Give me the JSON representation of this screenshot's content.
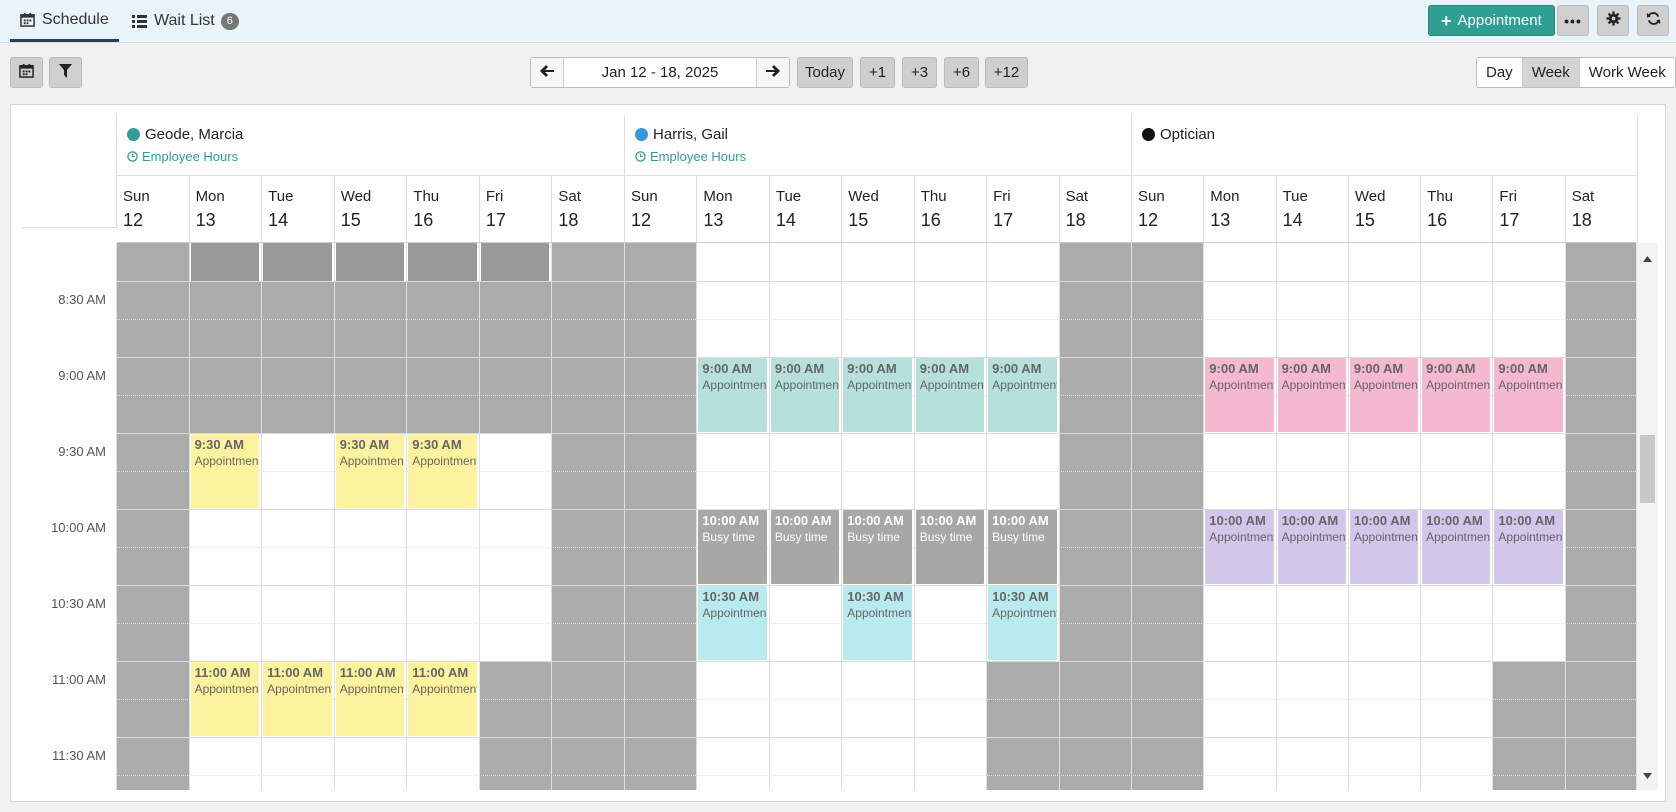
{
  "tabs": [
    {
      "label": "Schedule",
      "icon": "calendar-icon",
      "active": true
    },
    {
      "label": "Wait List",
      "icon": "list-icon",
      "badge": "6"
    }
  ],
  "header": {
    "appointment_label": "Appointment"
  },
  "toolbar": {
    "date_range": "Jan 12 - 18, 2025",
    "today": "Today",
    "jumps": [
      "+1",
      "+3",
      "+6",
      "+12"
    ],
    "views": [
      "Day",
      "Week",
      "Work Week"
    ],
    "selected_view": "Week"
  },
  "colors": {
    "accent": "#2f9e93",
    "off_hours": "#ababab",
    "yellow": "#fdf29e",
    "teal": "#b6e0db",
    "cyan": "#b8eaef",
    "pink": "#f4b8cf",
    "lavender": "#d2c6ea",
    "busy": "#a7a7a7"
  },
  "resources": [
    {
      "name": "Geode, Marcia",
      "dot": "#2f9e93",
      "hours_label": "Employee Hours"
    },
    {
      "name": "Harris, Gail",
      "dot": "#3498db",
      "hours_label": "Employee Hours"
    },
    {
      "name": "Optician",
      "dot": "#111111",
      "hours_label": ""
    }
  ],
  "days": [
    {
      "name": "Sun",
      "num": "12"
    },
    {
      "name": "Mon",
      "num": "13"
    },
    {
      "name": "Tue",
      "num": "14"
    },
    {
      "name": "Wed",
      "num": "15"
    },
    {
      "name": "Thu",
      "num": "16"
    },
    {
      "name": "Fri",
      "num": "17"
    },
    {
      "name": "Sat",
      "num": "18"
    }
  ],
  "time_labels": [
    "8:30 AM",
    "9:00 AM",
    "9:30 AM",
    "10:00 AM",
    "10:30 AM",
    "11:00 AM",
    "11:30 AM"
  ],
  "events": [
    {
      "resource": 0,
      "day": 1,
      "start": 2,
      "end": 4,
      "time": "9:30 AM",
      "label": "Appointment",
      "color": "yellow"
    },
    {
      "resource": 0,
      "day": 3,
      "start": 2,
      "end": 4,
      "time": "9:30 AM",
      "label": "Appointment",
      "color": "yellow"
    },
    {
      "resource": 0,
      "day": 4,
      "start": 2,
      "end": 4,
      "time": "9:30 AM",
      "label": "Appointment",
      "color": "yellow"
    },
    {
      "resource": 0,
      "day": 1,
      "start": 6,
      "end": 8,
      "time": "11:00 AM",
      "label": "Appointment",
      "color": "yellow"
    },
    {
      "resource": 0,
      "day": 2,
      "start": 6,
      "end": 8,
      "time": "11:00 AM",
      "label": "Appointment",
      "color": "yellow"
    },
    {
      "resource": 0,
      "day": 3,
      "start": 6,
      "end": 8,
      "time": "11:00 AM",
      "label": "Appointment",
      "color": "yellow"
    },
    {
      "resource": 0,
      "day": 4,
      "start": 6,
      "end": 8,
      "time": "11:00 AM",
      "label": "Appointment",
      "color": "yellow"
    },
    {
      "resource": 1,
      "day": 1,
      "start": 0,
      "end": 2,
      "time": "9:00 AM",
      "label": "Appointment",
      "color": "teal"
    },
    {
      "resource": 1,
      "day": 2,
      "start": 0,
      "end": 2,
      "time": "9:00 AM",
      "label": "Appointment",
      "color": "teal"
    },
    {
      "resource": 1,
      "day": 3,
      "start": 0,
      "end": 2,
      "time": "9:00 AM",
      "label": "Appointment",
      "color": "teal"
    },
    {
      "resource": 1,
      "day": 4,
      "start": 0,
      "end": 2,
      "time": "9:00 AM",
      "label": "Appointment",
      "color": "teal"
    },
    {
      "resource": 1,
      "day": 5,
      "start": 0,
      "end": 2,
      "time": "9:00 AM",
      "label": "Appointment",
      "color": "teal"
    },
    {
      "resource": 1,
      "day": 1,
      "start": 4,
      "end": 6,
      "time": "10:00 AM",
      "label": "Busy time",
      "color": "busy"
    },
    {
      "resource": 1,
      "day": 2,
      "start": 4,
      "end": 6,
      "time": "10:00 AM",
      "label": "Busy time",
      "color": "busy"
    },
    {
      "resource": 1,
      "day": 3,
      "start": 4,
      "end": 6,
      "time": "10:00 AM",
      "label": "Busy time",
      "color": "busy"
    },
    {
      "resource": 1,
      "day": 4,
      "start": 4,
      "end": 6,
      "time": "10:00 AM",
      "label": "Busy time",
      "color": "busy"
    },
    {
      "resource": 1,
      "day": 5,
      "start": 4,
      "end": 6,
      "time": "10:00 AM",
      "label": "Busy time",
      "color": "busy"
    },
    {
      "resource": 1,
      "day": 1,
      "start": 6,
      "end": 8,
      "time": "10:30 AM",
      "label": "Appointment",
      "color": "cyan"
    },
    {
      "resource": 1,
      "day": 3,
      "start": 6,
      "end": 8,
      "time": "10:30 AM",
      "label": "Appointment",
      "color": "cyan"
    },
    {
      "resource": 1,
      "day": 5,
      "start": 6,
      "end": 8,
      "time": "10:30 AM",
      "label": "Appointment",
      "color": "cyan"
    },
    {
      "resource": 2,
      "day": 1,
      "start": 0,
      "end": 2,
      "time": "9:00 AM",
      "label": "Appointment",
      "color": "pink"
    },
    {
      "resource": 2,
      "day": 2,
      "start": 0,
      "end": 2,
      "time": "9:00 AM",
      "label": "Appointment",
      "color": "pink"
    },
    {
      "resource": 2,
      "day": 3,
      "start": 0,
      "end": 2,
      "time": "9:00 AM",
      "label": "Appointment",
      "color": "pink"
    },
    {
      "resource": 2,
      "day": 4,
      "start": 0,
      "end": 2,
      "time": "9:00 AM",
      "label": "Appointment",
      "color": "pink"
    },
    {
      "resource": 2,
      "day": 5,
      "start": 0,
      "end": 2,
      "time": "9:00 AM",
      "label": "Appointment",
      "color": "pink"
    },
    {
      "resource": 2,
      "day": 1,
      "start": 4,
      "end": 6,
      "time": "10:00 AM",
      "label": "Appointment",
      "color": "lavender"
    },
    {
      "resource": 2,
      "day": 2,
      "start": 4,
      "end": 6,
      "time": "10:00 AM",
      "label": "Appointment",
      "color": "lavender"
    },
    {
      "resource": 2,
      "day": 3,
      "start": 4,
      "end": 6,
      "time": "10:00 AM",
      "label": "Appointment",
      "color": "lavender"
    },
    {
      "resource": 2,
      "day": 4,
      "start": 4,
      "end": 6,
      "time": "10:00 AM",
      "label": "Appointment",
      "color": "lavender"
    },
    {
      "resource": 2,
      "day": 5,
      "start": 4,
      "end": 6,
      "time": "10:00 AM",
      "label": "Appointment",
      "color": "lavender"
    }
  ]
}
